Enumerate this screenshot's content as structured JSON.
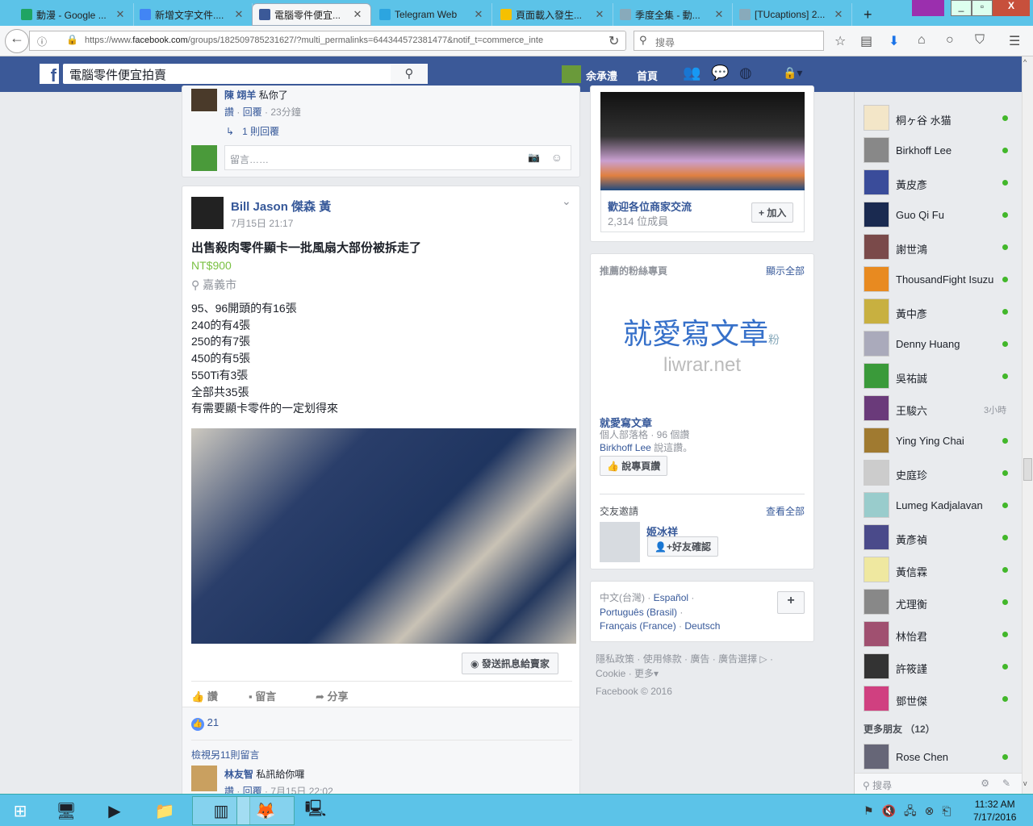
{
  "browser": {
    "tabs": [
      {
        "label": "動漫 - Google ...",
        "color": "#1fa463"
      },
      {
        "label": "新增文字文件....",
        "color": "#4285f4"
      },
      {
        "label": "電腦零件便宜...",
        "color": "#3b5998",
        "active": true
      },
      {
        "label": "Telegram Web",
        "color": "#2ca5e0"
      },
      {
        "label": "頁面載入發生...",
        "color": "#f5c000"
      },
      {
        "label": "季度全集 - 動...",
        "color": "#8ab"
      },
      {
        "label": "[TUcaptions] 2...",
        "color": "#8ab"
      }
    ],
    "new_tab": "+",
    "url_prefix": "https://www.",
    "url_domain": "facebook.com",
    "url_rest": "/groups/182509785231627/?multi_permalinks=644344572381477&notif_t=commerce_inte",
    "search_placeholder": "搜尋"
  },
  "fb": {
    "search_value": "電腦零件便宜拍賣",
    "user_name": "余承澧",
    "home": "首頁"
  },
  "prev_comment": {
    "author": "陳 翊羊",
    "text": "私你了",
    "like": "讚",
    "reply": "回覆",
    "time": "23分鐘",
    "replies": "1 則回覆",
    "input_placeholder": "留言……"
  },
  "post": {
    "author": "Bill Jason 傑森 黃",
    "time": "7月15日 21:17",
    "title": "出售殺肉零件顯卡一批風扇大部份被拆走了",
    "price": "NT$900",
    "location": "嘉義市",
    "lines": [
      "95、96開頭的有16張",
      "240的有4張",
      "250的有7張",
      "450的有5張",
      "550Ti有3張",
      "全部共35張",
      "有需要顯卡零件的一定划得來"
    ],
    "message_seller": "發送訊息給賣家",
    "actions": {
      "like": "讚",
      "comment": "留言",
      "share": "分享"
    },
    "likes": "21",
    "view_more": "檢視另11則留言",
    "comment": {
      "author": "林友智",
      "text": "私訊給你囉",
      "like": "讚",
      "reply": "回覆",
      "time": "7月15日 22:02"
    }
  },
  "group": {
    "name": "歡迎各位商家交流",
    "members": "2,314 位成員",
    "join": "加入"
  },
  "pages": {
    "header": "推薦的粉絲專頁",
    "show_all": "顯示全部",
    "logo_text": "就愛寫文章",
    "logo_badge": "粉",
    "logo_url": "liwrar.net",
    "name": "就愛寫文章",
    "meta": "個人部落格 · 96 個讚",
    "friend_like": "Birkhoff Lee",
    "friend_like_suffix": " 說這讚。",
    "like_btn": "說專頁讚"
  },
  "requests": {
    "header": "交友邀請",
    "see_all": "查看全部",
    "name": "姬冰祥",
    "confirm": "好友確認"
  },
  "languages": {
    "current": "中文(台灣)",
    "items": [
      "Español",
      "Português (Brasil)",
      "Français (France)",
      "Deutsch"
    ],
    "add": "+"
  },
  "footer": {
    "links": [
      "隱私政策",
      "使用條款",
      "廣告",
      "廣告選擇",
      "Cookie",
      "更多"
    ],
    "copyright": "Facebook © 2016"
  },
  "chat": {
    "friends": [
      {
        "name": "桐ヶ谷 水猫",
        "online": true,
        "color": "#f3e6c8"
      },
      {
        "name": "Birkhoff Lee",
        "online": true,
        "color": "#888"
      },
      {
        "name": "黃皮彥",
        "online": true,
        "color": "#3a4c9a"
      },
      {
        "name": "Guo Qi Fu",
        "online": true,
        "color": "#1a2a50"
      },
      {
        "name": "謝世鴻",
        "online": true,
        "color": "#7a4a4a"
      },
      {
        "name": "ThousandFight Isuzu",
        "online": true,
        "color": "#e88a20"
      },
      {
        "name": "黃中彥",
        "online": true,
        "color": "#c8b040"
      },
      {
        "name": "Denny Huang",
        "online": true,
        "color": "#aab"
      },
      {
        "name": "吳祐誠",
        "online": true,
        "color": "#3a9a3a"
      },
      {
        "name": "王駿六",
        "online": false,
        "ago": "3小時",
        "color": "#6a3a7a"
      },
      {
        "name": "Ying Ying Chai",
        "online": true,
        "color": "#a07a30"
      },
      {
        "name": "史庭珍",
        "online": true,
        "color": "#ccc"
      },
      {
        "name": "Lumeg Kadjalavan",
        "online": true,
        "color": "#9cc"
      },
      {
        "name": "黃彥禎",
        "online": true,
        "color": "#4a4a8a"
      },
      {
        "name": "黃信霖",
        "online": true,
        "color": "#efe8a0"
      },
      {
        "name": "尤理衡",
        "online": true,
        "color": "#888"
      },
      {
        "name": "林怡君",
        "online": true,
        "color": "#a05070"
      },
      {
        "name": "許筱謹",
        "online": true,
        "color": "#333"
      },
      {
        "name": "鄧世傑",
        "online": true,
        "color": "#d04080"
      }
    ],
    "more_header": "更多朋友 （12）",
    "more": [
      {
        "name": "Rose Chen",
        "online": true,
        "color": "#667"
      }
    ],
    "search_placeholder": "搜尋"
  },
  "taskbar": {
    "time": "11:32 AM",
    "date": "7/17/2016"
  }
}
